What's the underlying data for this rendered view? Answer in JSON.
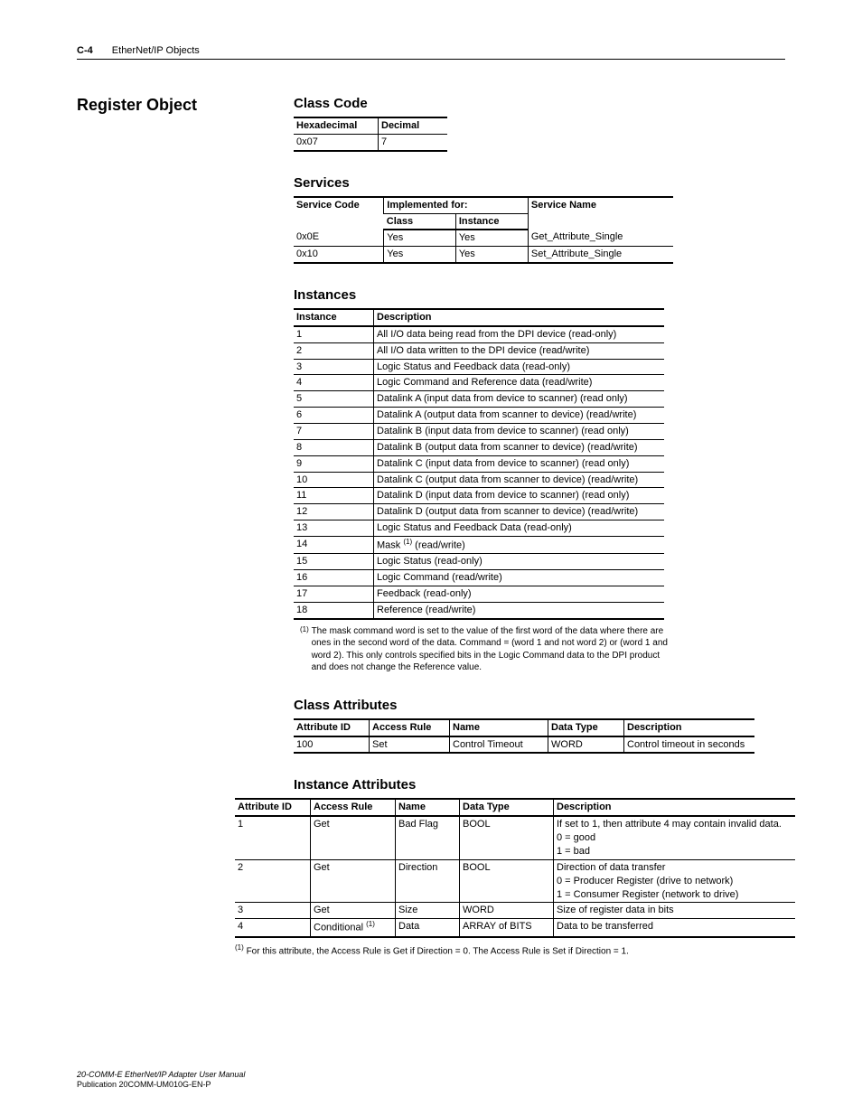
{
  "header": {
    "page_num": "C-4",
    "chapter": "EtherNet/IP Objects"
  },
  "section_title": "Register Object",
  "class_code": {
    "heading": "Class Code",
    "cols": [
      "Hexadecimal",
      "Decimal"
    ],
    "row": [
      "0x07",
      "7"
    ]
  },
  "services": {
    "heading": "Services",
    "h1": "Service Code",
    "h2": "Implemented for:",
    "h3": "Service Name",
    "sub1": "Class",
    "sub2": "Instance",
    "rows": [
      [
        "0x0E",
        "Yes",
        "Yes",
        "Get_Attribute_Single"
      ],
      [
        "0x10",
        "Yes",
        "Yes",
        "Set_Attribute_Single"
      ]
    ]
  },
  "instances": {
    "heading": "Instances",
    "cols": [
      "Instance",
      "Description"
    ],
    "rows": [
      [
        "1",
        "All I/O data being read from the DPI device (read-only)"
      ],
      [
        "2",
        "All I/O data written to the DPI device (read/write)"
      ],
      [
        "3",
        "Logic Status and Feedback data (read-only)"
      ],
      [
        "4",
        "Logic Command and Reference data (read/write)"
      ],
      [
        "5",
        "Datalink A (input data from device to scanner) (read only)"
      ],
      [
        "6",
        "Datalink A (output data from scanner to device) (read/write)"
      ],
      [
        "7",
        "Datalink B (input data from device to scanner) (read only)"
      ],
      [
        "8",
        "Datalink B (output data from scanner to device) (read/write)"
      ],
      [
        "9",
        "Datalink C (input data from device to scanner) (read only)"
      ],
      [
        "10",
        "Datalink C (output data from scanner to device) (read/write)"
      ],
      [
        "11",
        "Datalink D (input data from device to scanner) (read only)"
      ],
      [
        "12",
        "Datalink D (output data from scanner to device) (read/write)"
      ],
      [
        "13",
        "Logic Status and Feedback Data (read-only)"
      ],
      [
        "14",
        "Mask (1) (read/write)"
      ],
      [
        "15",
        "Logic Status (read-only)"
      ],
      [
        "16",
        "Logic Command (read/write)"
      ],
      [
        "17",
        "Feedback (read-only)"
      ],
      [
        "18",
        "Reference (read/write)"
      ]
    ],
    "footnote_mark": "(1)",
    "footnote": "The mask command word is set to the value of the first word of the data where there are ones in the second word of the data. Command = (word 1 and not word 2) or (word 1 and word 2). This only controls specified bits in the Logic Command data to the DPI product and does not change the Reference value."
  },
  "class_attrs": {
    "heading": "Class Attributes",
    "cols": [
      "Attribute ID",
      "Access Rule",
      "Name",
      "Data Type",
      "Description"
    ],
    "rows": [
      [
        "100",
        "Set",
        "Control Timeout",
        "WORD",
        "Control timeout in seconds"
      ]
    ]
  },
  "inst_attrs": {
    "heading": "Instance Attributes",
    "cols": [
      "Attribute ID",
      "Access Rule",
      "Name",
      "Data Type",
      "Description"
    ],
    "rows": [
      {
        "c": [
          "1",
          "Get",
          "Bad Flag",
          "BOOL"
        ],
        "d": [
          "If set to 1, then attribute 4 may contain invalid data.",
          "0 = good",
          "1 = bad"
        ]
      },
      {
        "c": [
          "2",
          "Get",
          "Direction",
          "BOOL"
        ],
        "d": [
          "Direction of data transfer",
          "0 = Producer Register (drive to network)",
          "1 = Consumer Register (network to drive)"
        ]
      },
      {
        "c": [
          "3",
          "Get",
          "Size",
          "WORD"
        ],
        "d": [
          "Size of register data in bits"
        ]
      },
      {
        "c": [
          "4",
          "Conditional (1)",
          "Data",
          "ARRAY of BITS"
        ],
        "d": [
          "Data to be transferred"
        ]
      }
    ],
    "footnote_mark": "(1)",
    "footnote": "For this attribute, the Access Rule is Get if Direction = 0. The Access Rule is Set if Direction = 1."
  },
  "footer": {
    "line1": "20-COMM-E EtherNet/IP Adapter User Manual",
    "line2": "Publication 20COMM-UM010G-EN-P"
  }
}
